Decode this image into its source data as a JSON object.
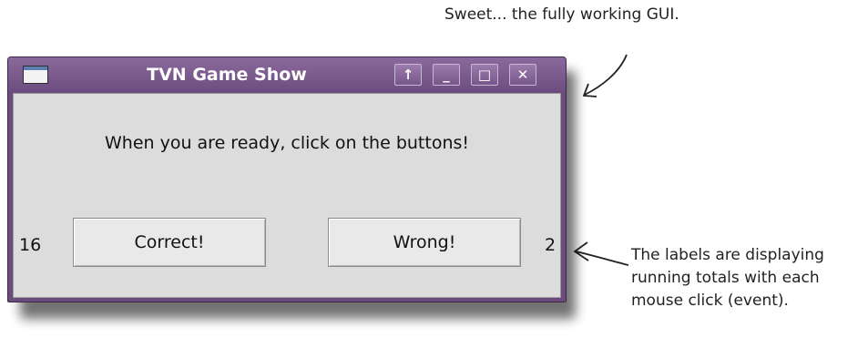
{
  "window": {
    "title": "TVN Game Show",
    "controls": {
      "restore_label": "↑",
      "minimize_label": "_",
      "maximize_label": "□",
      "close_label": "✕"
    }
  },
  "content": {
    "prompt": "When you are ready, click on the buttons!",
    "correct_count": "16",
    "correct_button_label": "Correct!",
    "wrong_button_label": "Wrong!",
    "wrong_count": "2"
  },
  "annotations": {
    "top_note": "Sweet... the fully working GUI.",
    "right_note_lines": [
      "The labels are displaying",
      "running totals with each",
      "mouse click (event)."
    ]
  },
  "colors": {
    "frame": "#6b4a7e",
    "client_bg": "#dcdcdc"
  }
}
